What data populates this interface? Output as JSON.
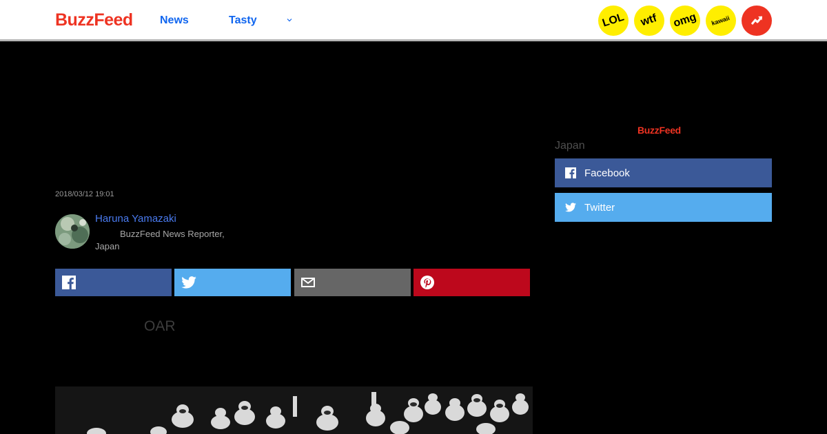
{
  "nav": {
    "logo": "BuzzFeed",
    "links": [
      "News",
      "Tasty"
    ],
    "badges": [
      "LOL",
      "wtf",
      "omg",
      "kawaii"
    ],
    "trending_icon": "trending-arrow-icon"
  },
  "article": {
    "timestamp": "2018/03/12 19:01",
    "author_name": "Haruna Yamazaki",
    "author_title": "BuzzFeed News Reporter, Japan",
    "share_icons": [
      "facebook-icon",
      "twitter-icon",
      "mail-icon",
      "pinterest-icon"
    ],
    "subhead": "OAR"
  },
  "sidebar": {
    "logo": "BuzzFeed",
    "caption": "Japan",
    "facebook_label": "Facebook",
    "twitter_label": "Twitter"
  },
  "colors": {
    "brand": "#ee3322",
    "link": "#0f65ef",
    "facebook": "#3b5998",
    "twitter": "#55acee",
    "mail": "#666666",
    "pinterest": "#bd081c",
    "badge": "#ffee00"
  }
}
